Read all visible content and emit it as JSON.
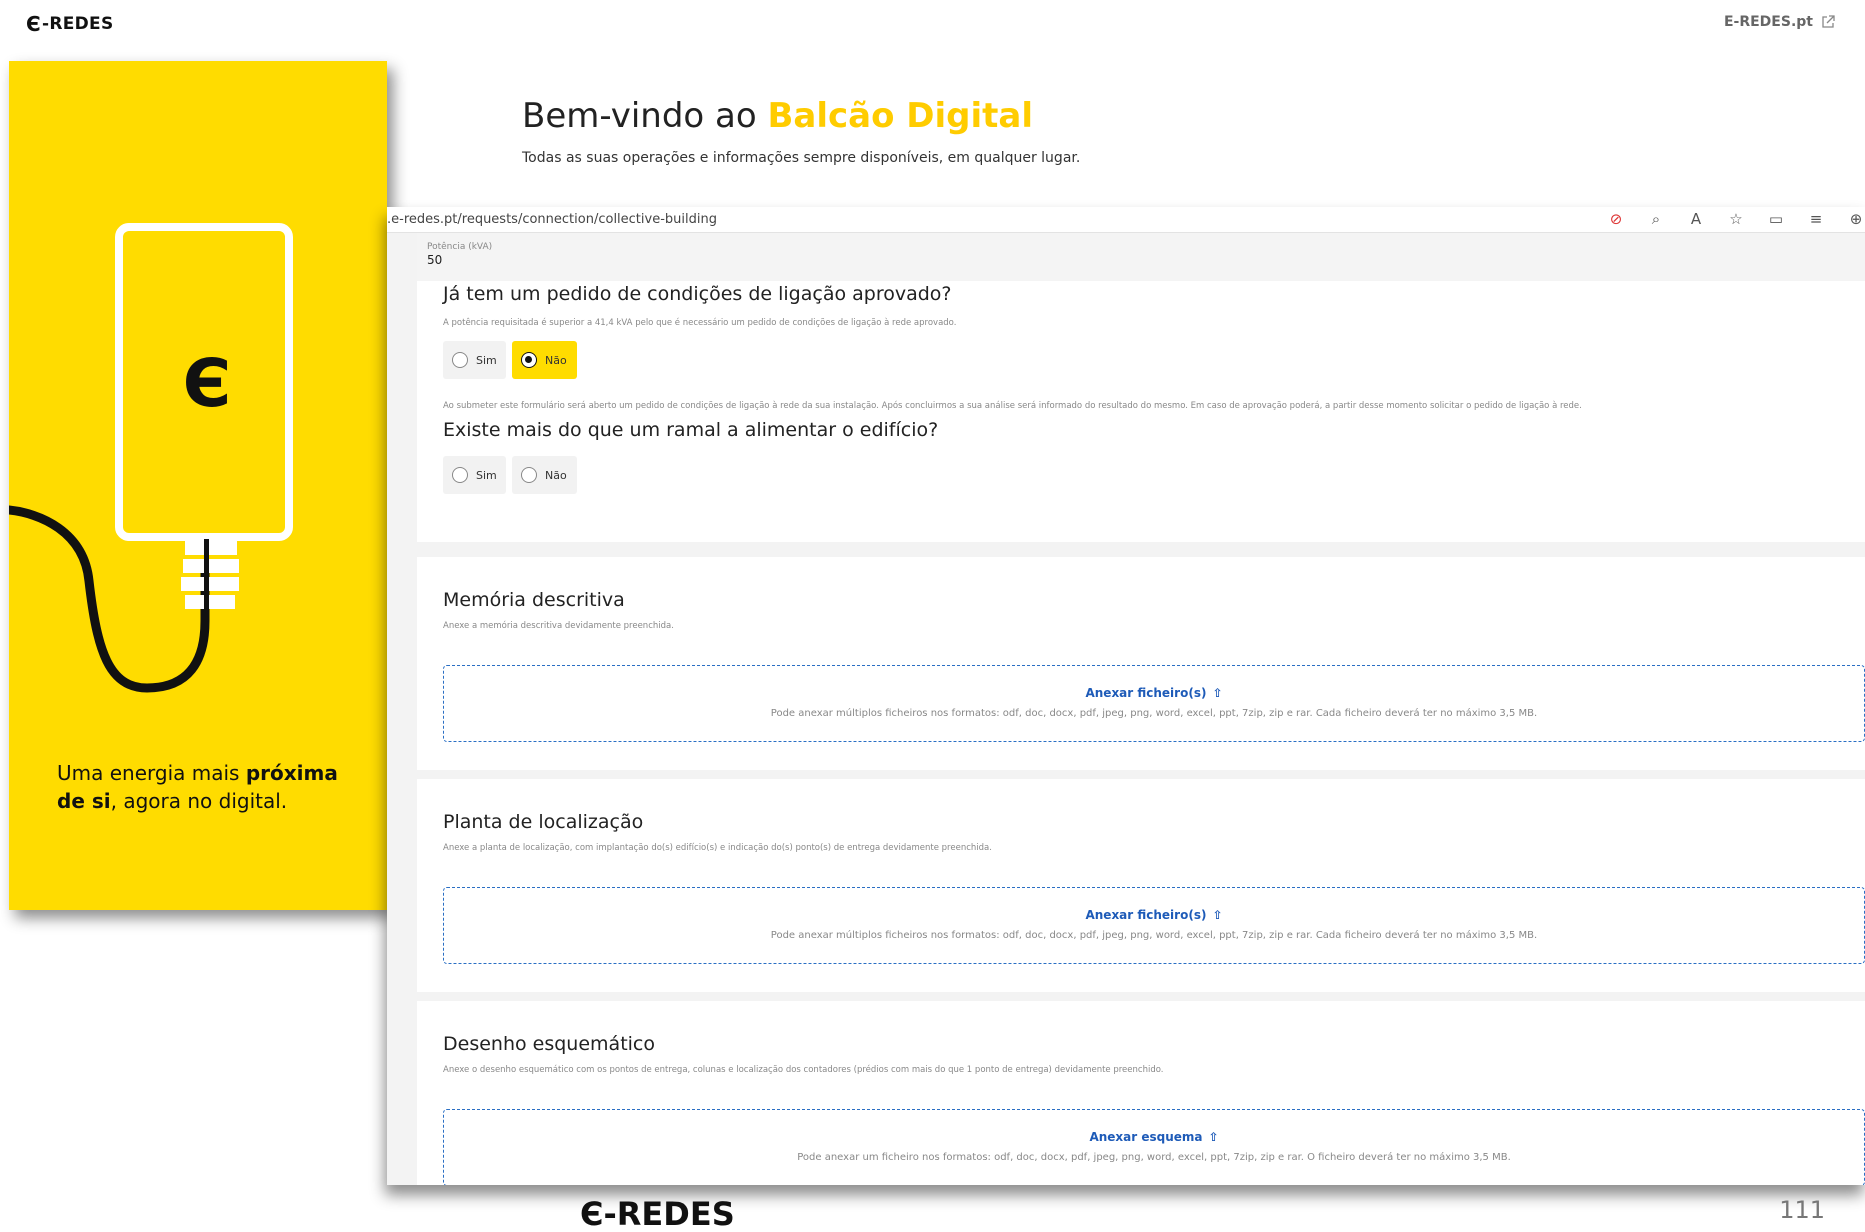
{
  "topbar": {
    "brand": "-REDES",
    "ext_link": "E-REDES.pt"
  },
  "welcome": {
    "title_prefix": "Bem-vindo ao ",
    "title_accent": "Balcão Digital",
    "subtitle": "Todas as suas operações e informações sempre disponíveis, em qualquer lugar."
  },
  "panel": {
    "tagline_1": "Uma energia mais ",
    "tagline_bold_1": "próxima",
    "tagline_bold_2": "de si",
    "tagline_2": ", agora no digital.",
    "colors": {
      "accent": "#ffdc00"
    }
  },
  "browser": {
    "url": ".e-redes.pt/requests/connection/collective-building"
  },
  "form": {
    "power_label": "Potência (kVA)",
    "power_value": "50",
    "q1": "Já tem um pedido de condições de ligação aprovado?",
    "q1_hint": "A potência requisitada é superior a 41,4 kVA pelo que é necessário um pedido de condições de ligação à rede aprovado.",
    "q1_options": [
      "Sim",
      "Não"
    ],
    "q1_selected": "Não",
    "submit_note": "Ao submeter este formulário será aberto um pedido de condições de ligação à rede da sua instalação. Após concluirmos a sua análise será informado do resultado do mesmo. Em caso de aprovação poderá, a partir desse momento solicitar o pedido de ligação à rede.",
    "q2": "Existe mais do que um ramal a alimentar o edifício?",
    "q2_options": [
      "Sim",
      "Não"
    ]
  },
  "uploads": [
    {
      "title": "Memória descritiva",
      "desc": "Anexe a memória descritiva devidamente preenchida.",
      "action": "Anexar ficheiro(s)",
      "info": "Pode anexar múltiplos ficheiros nos formatos: odf, doc, docx, pdf, jpeg, png, word, excel, ppt, 7zip, zip e rar. Cada ficheiro deverá ter no máximo 3,5 MB."
    },
    {
      "title": "Planta de localização",
      "desc": "Anexe a planta de localização, com implantação do(s) edifício(s) e indicação do(s) ponto(s) de entrega devidamente preenchida.",
      "action": "Anexar ficheiro(s)",
      "info": "Pode anexar múltiplos ficheiros nos formatos: odf, doc, docx, pdf, jpeg, png, word, excel, ppt, 7zip, zip e rar. Cada ficheiro deverá ter no máximo 3,5 MB."
    },
    {
      "title": "Desenho esquemático",
      "desc": "Anexe o desenho esquemático com os pontos de entrega, colunas e localização dos contadores (prédios com mais do que 1 ponto de entrega) devidamente preenchido.",
      "action": "Anexar esquema",
      "info": "Pode anexar um ficheiro nos formatos: odf, doc, docx, pdf, jpeg, png, word, excel, ppt, 7zip, zip e rar. O ficheiro deverá ter no máximo 3,5 MB."
    }
  ],
  "footer": {
    "brand": "-REDES",
    "page_number": "111"
  }
}
